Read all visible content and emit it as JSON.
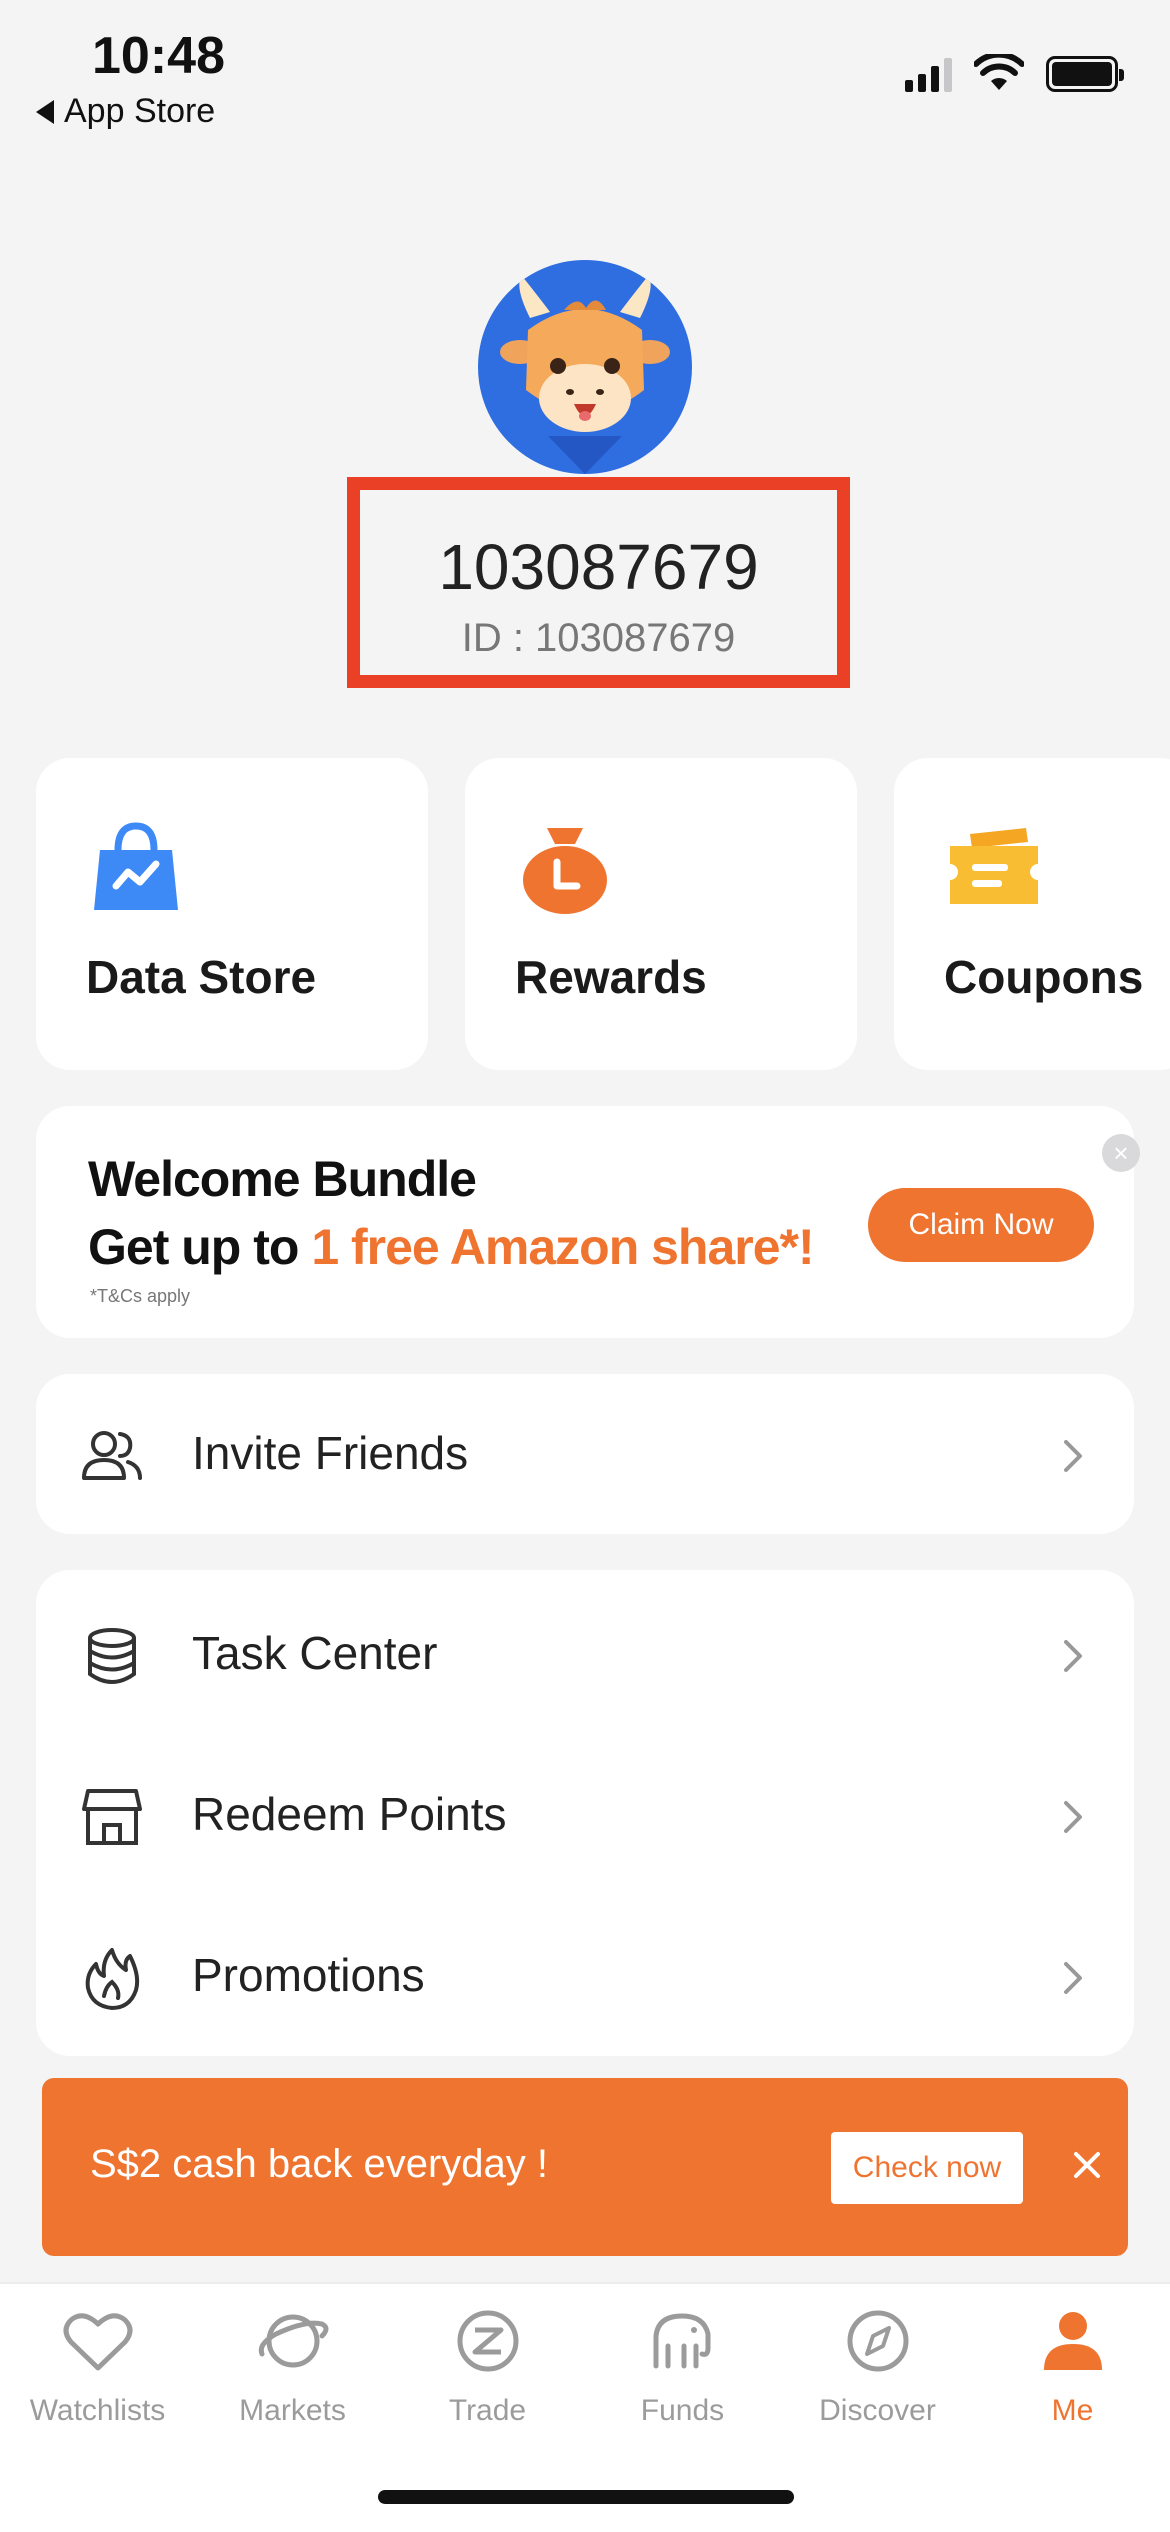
{
  "status": {
    "time": "10:48",
    "back_app": "App Store"
  },
  "profile": {
    "name": "103087679",
    "id_label": "ID : 103087679"
  },
  "quick_cards": [
    {
      "label": "Data Store",
      "icon": "shopping-bag-chart-icon"
    },
    {
      "label": "Rewards",
      "icon": "money-bag-icon"
    },
    {
      "label": "Coupons",
      "icon": "ticket-icon"
    }
  ],
  "welcome": {
    "title": "Welcome Bundle",
    "subtitle_prefix": "Get up to ",
    "subtitle_highlight": "1 free Amazon share*!",
    "tc": "*T&Cs apply",
    "cta": "Claim Now"
  },
  "menu": {
    "invite": "Invite Friends",
    "task_center": "Task Center",
    "redeem_points": "Redeem Points",
    "promotions": "Promotions"
  },
  "banner": {
    "text": "S$2 cash back everyday !",
    "cta": "Check now"
  },
  "tabs": [
    {
      "label": "Watchlists",
      "icon": "heart-icon"
    },
    {
      "label": "Markets",
      "icon": "planet-icon"
    },
    {
      "label": "Trade",
      "icon": "trade-z-icon"
    },
    {
      "label": "Funds",
      "icon": "elephant-icon"
    },
    {
      "label": "Discover",
      "icon": "compass-icon"
    },
    {
      "label": "Me",
      "icon": "person-icon"
    }
  ],
  "colors": {
    "accent": "#ef7430",
    "highlight_box": "#ea4126",
    "avatar_bg": "#2f6ee0"
  }
}
